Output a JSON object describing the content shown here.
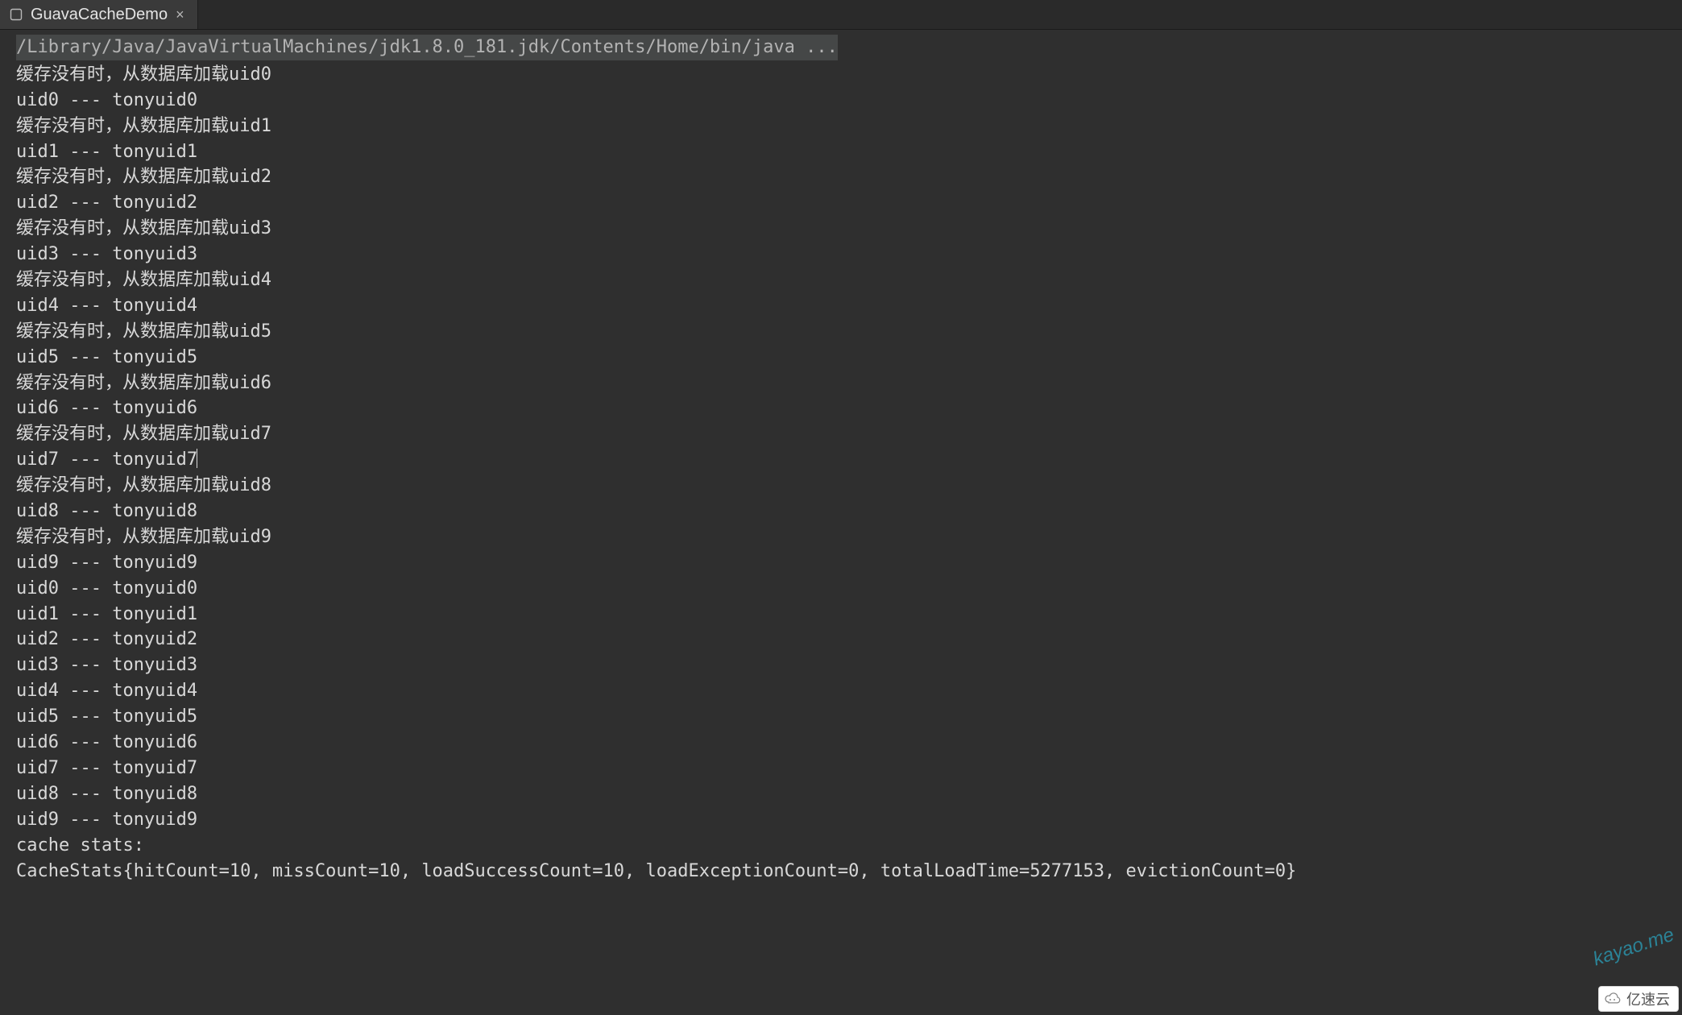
{
  "tab": {
    "title": "GuavaCacheDemo",
    "close_label": "×",
    "icon": "run-icon"
  },
  "console": {
    "command": "/Library/Java/JavaVirtualMachines/jdk1.8.0_181.jdk/Contents/Home/bin/java ...",
    "lines": [
      "缓存没有时，从数据库加载uid0",
      "uid0 --- tonyuid0",
      "缓存没有时，从数据库加载uid1",
      "uid1 --- tonyuid1",
      "缓存没有时，从数据库加载uid2",
      "uid2 --- tonyuid2",
      "缓存没有时，从数据库加载uid3",
      "uid3 --- tonyuid3",
      "缓存没有时，从数据库加载uid4",
      "uid4 --- tonyuid4",
      "缓存没有时，从数据库加载uid5",
      "uid5 --- tonyuid5",
      "缓存没有时，从数据库加载uid6",
      "uid6 --- tonyuid6",
      "缓存没有时，从数据库加载uid7",
      "uid7 --- tonyuid7",
      "缓存没有时，从数据库加载uid8",
      "uid8 --- tonyuid8",
      "缓存没有时，从数据库加载uid9",
      "uid9 --- tonyuid9",
      "uid0 --- tonyuid0",
      "uid1 --- tonyuid1",
      "uid2 --- tonyuid2",
      "uid3 --- tonyuid3",
      "uid4 --- tonyuid4",
      "uid5 --- tonyuid5",
      "uid6 --- tonyuid6",
      "uid7 --- tonyuid7",
      "uid8 --- tonyuid8",
      "uid9 --- tonyuid9",
      "cache stats:",
      "CacheStats{hitCount=10, missCount=10, loadSuccessCount=10, loadExceptionCount=0, totalLoadTime=5277153, evictionCount=0}"
    ],
    "caret_line_index": 15
  },
  "watermark": "kayao.me",
  "brand": "亿速云"
}
